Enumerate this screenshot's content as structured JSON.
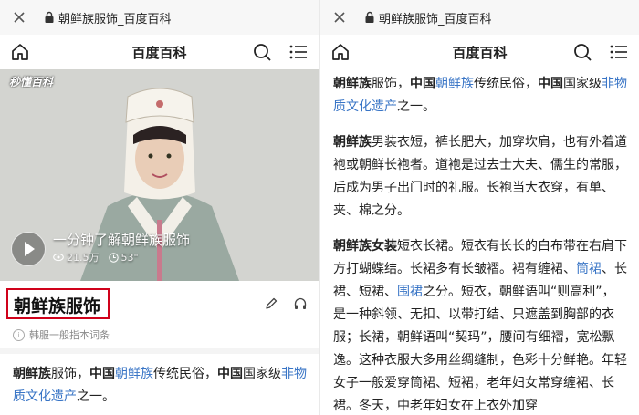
{
  "browser": {
    "url_title": "朝鲜族服饰_百度百科"
  },
  "nav": {
    "brand": "百度百科"
  },
  "video": {
    "watermark": "秒懂百科",
    "title": "一分钟了解朝鲜族服饰",
    "views": "21.5万",
    "duration": "53\""
  },
  "entry": {
    "title": "朝鲜族服饰",
    "alias_note": "韩服一般指本词条"
  },
  "intro": {
    "term": "朝鲜族",
    "t1": "服饰，",
    "bold_country": "中国",
    "link_ethnic": "朝鲜族",
    "t2": "传统民俗，",
    "bold_country2": "中国",
    "t3": "国家级",
    "link_heritage": "非物质文化遗产",
    "t4": "之一。"
  },
  "men": {
    "term": "朝鲜族",
    "text": "男装衣短，裤长肥大，加穿坎肩，也有外着道袍或朝鲜长袍者。道袍是过去士大夫、儒生的常服，后成为男子出门时的礼服。长袍当大衣穿，有单、夹、棉之分。"
  },
  "women": {
    "term": "朝鲜族女装",
    "t1": "短衣长裙。短衣有长长的白布带在右肩下方打蝴蝶结。长裙多有长皱褶。裙有缠裙、",
    "link_skirt": "筒裙",
    "t2": "、长裙、短裙、",
    "link_apron": "围裙",
    "t3": "之分。短衣，朝鲜语叫“则高利”，是一种斜领、无扣、以带打结、只遮盖到胸部的衣服；长裙，朝鲜语叫“契玛”，腰间有细褶，宽松飘逸。这种衣服大多用丝绸缝制，色彩十分鲜艳。年轻女子一般爱穿筒裙、短裙，老年妇女常穿缠裙、长裙。冬天，中老年妇女在上衣外加穿"
  },
  "colors": {
    "accent_red": "#d0021b",
    "link_blue": "#3975c6"
  }
}
